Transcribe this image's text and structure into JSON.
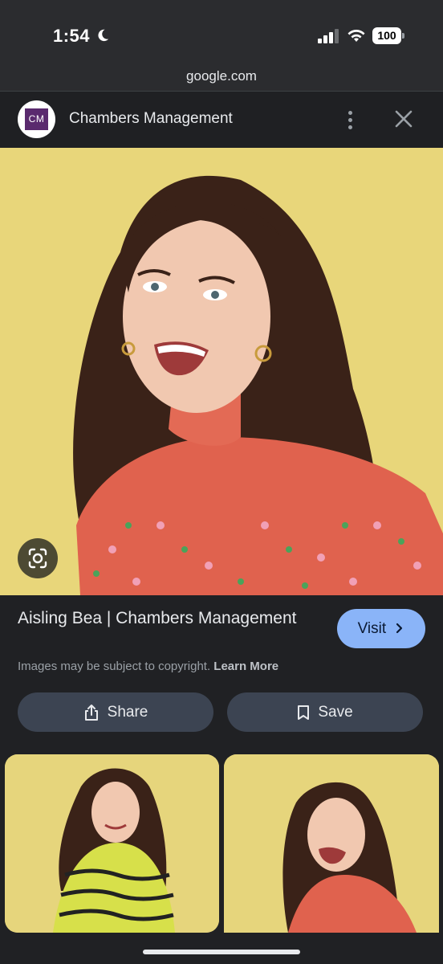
{
  "status_bar": {
    "time": "1:54",
    "battery": "100"
  },
  "url_bar": {
    "host": "google.com"
  },
  "header": {
    "logo_text": "CM",
    "site_name": "Chambers Management"
  },
  "result": {
    "title": "Aisling Bea | Chambers Management",
    "visit_label": "Visit",
    "copyright_text": "Images may be subject to copyright.",
    "learn_more": "Learn More"
  },
  "actions": {
    "share_label": "Share",
    "save_label": "Save"
  },
  "colors": {
    "accent": "#8ab4f8",
    "background": "#202124",
    "pill": "#3c4452",
    "hero_bg": "#e8d67a"
  }
}
